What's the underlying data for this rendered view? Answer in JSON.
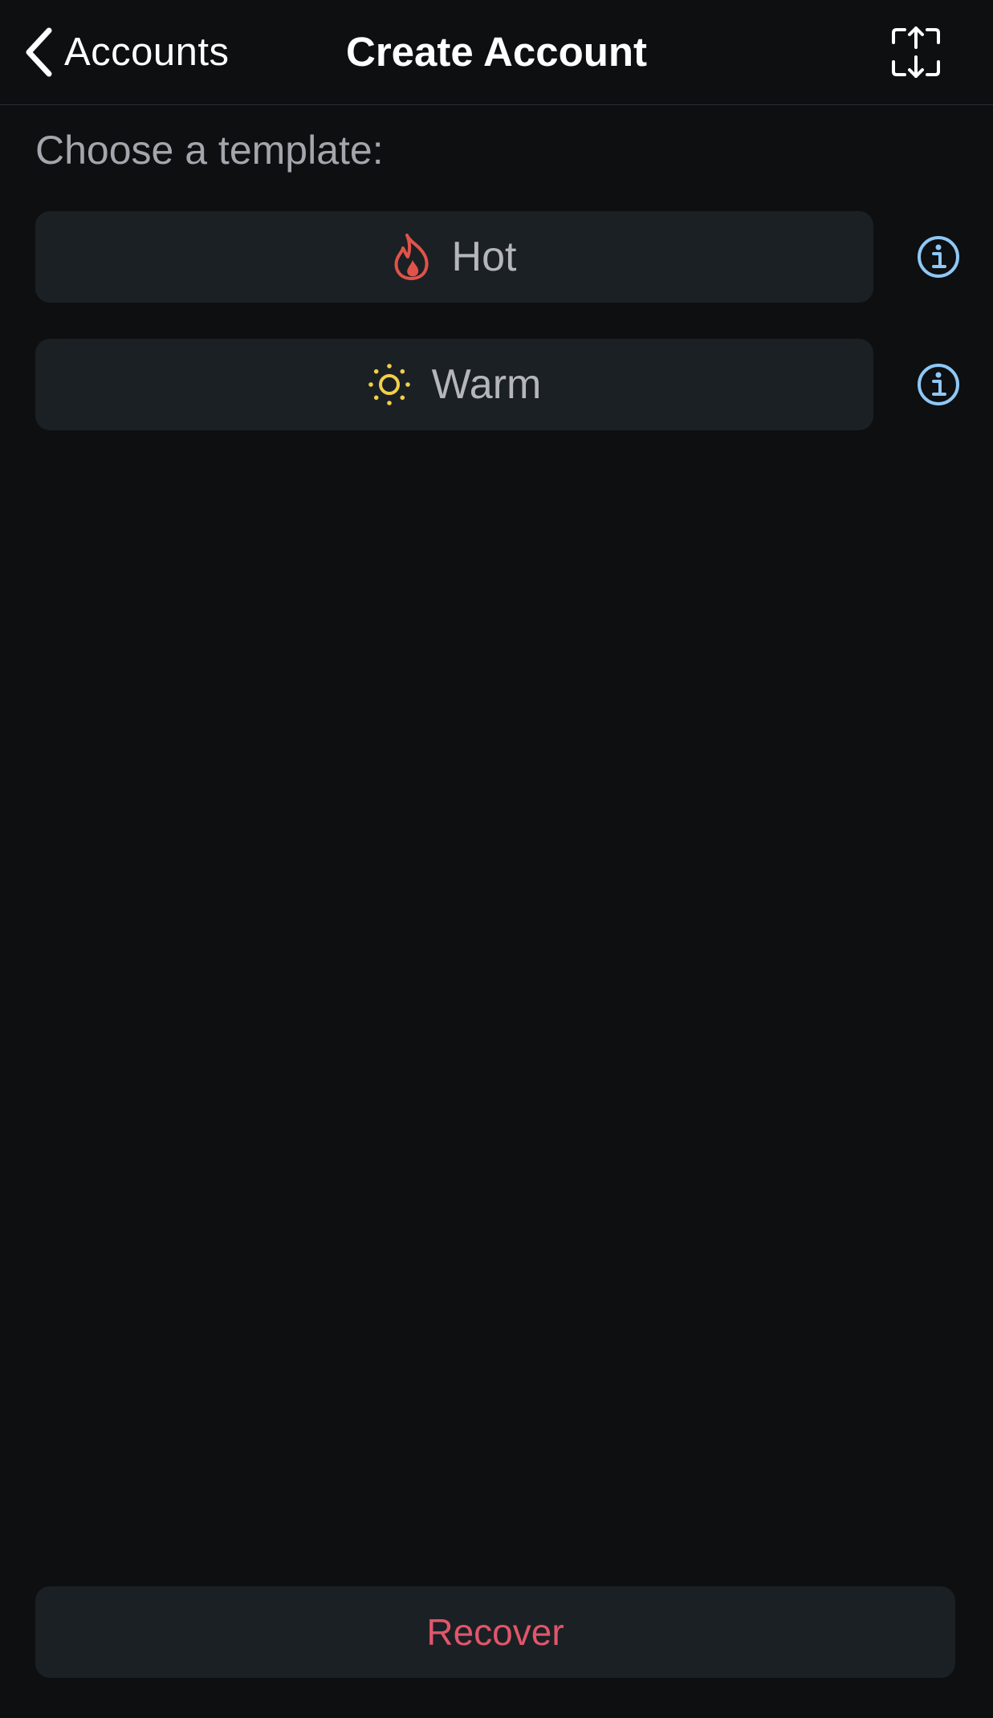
{
  "navbar": {
    "back_label": "Accounts",
    "title": "Create Account",
    "back_icon": "chevron-left-icon",
    "scan_icon": "scan-import-icon"
  },
  "content": {
    "section_label": "Choose a template:",
    "templates": [
      {
        "label": "Hot",
        "icon": "flame-icon",
        "icon_color": "#e0534a",
        "info_icon": "info-icon"
      },
      {
        "label": "Warm",
        "icon": "sun-icon",
        "icon_color": "#f2cf49",
        "info_icon": "info-icon"
      }
    ]
  },
  "footer": {
    "recover_label": "Recover",
    "recover_color": "#e0566b"
  },
  "colors": {
    "background": "#0e0f11",
    "button_bg": "#1b2024",
    "info_accent": "#8ec8f6",
    "secondary_text": "#a3a6ab"
  }
}
